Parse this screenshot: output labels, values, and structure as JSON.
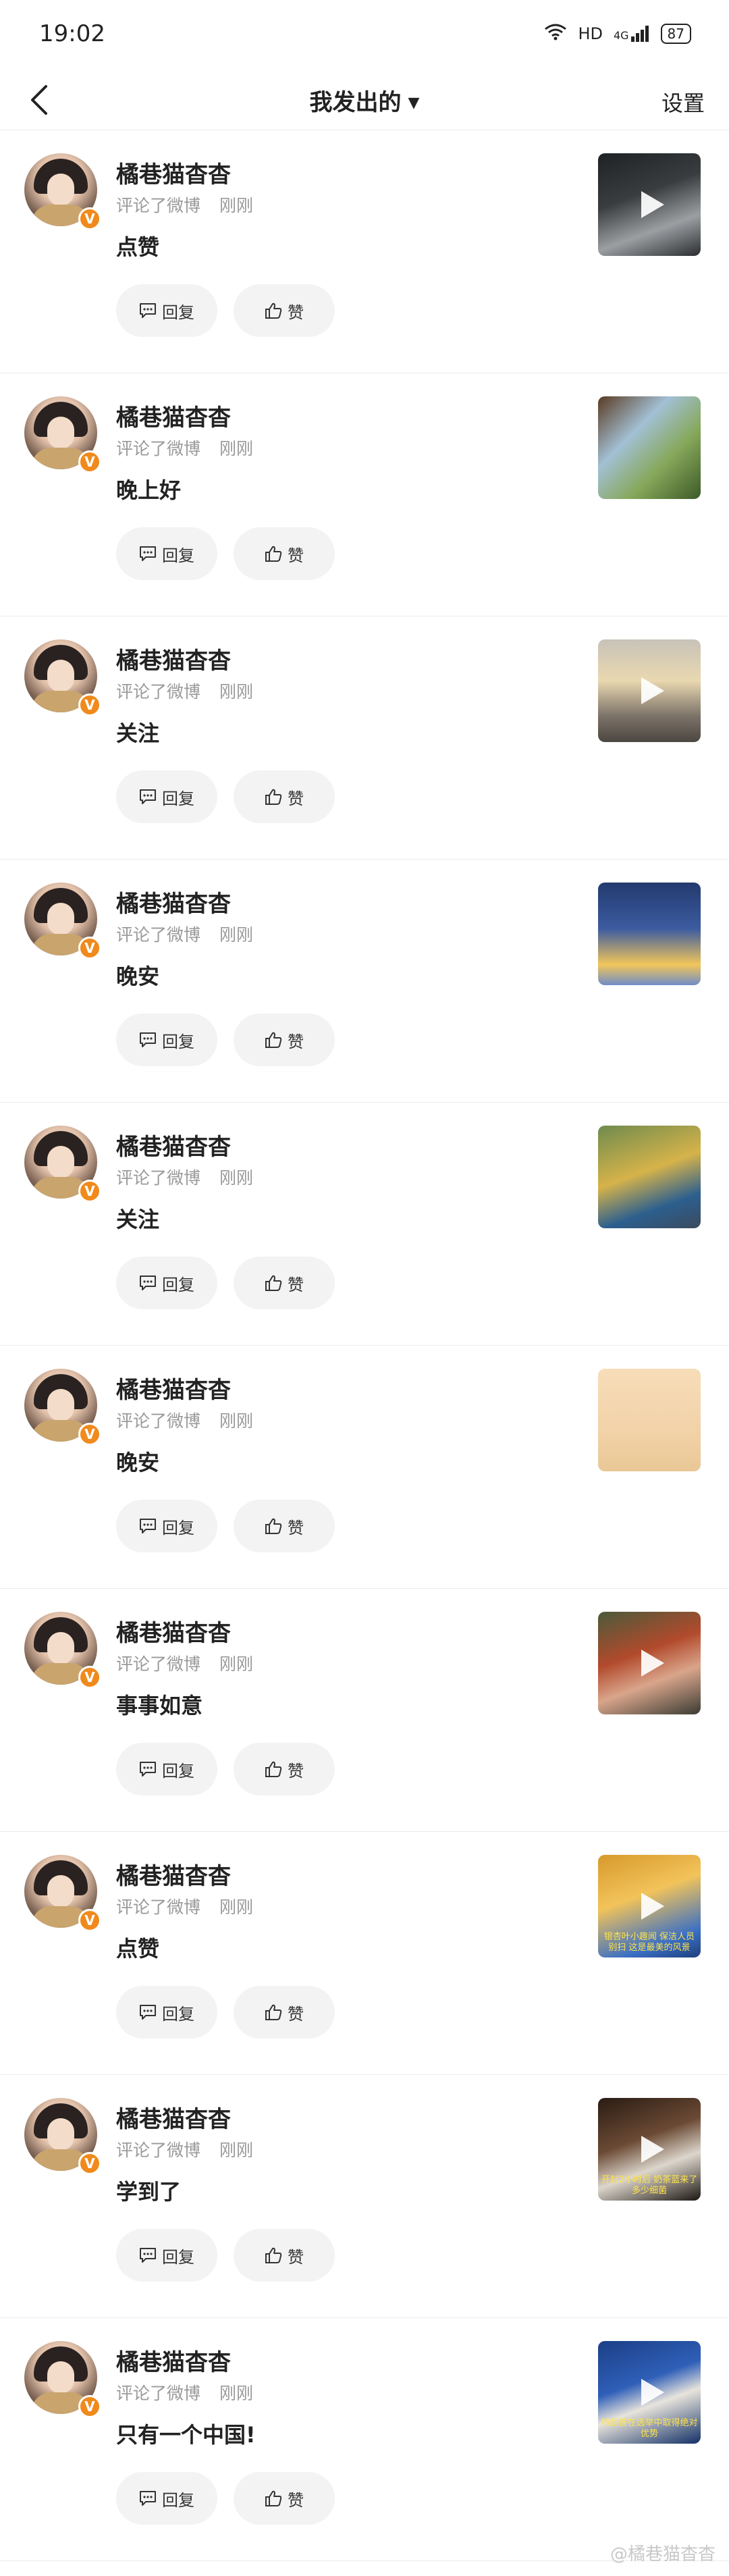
{
  "status_bar": {
    "time": "19:02",
    "network": "HD",
    "signal": "4G",
    "battery": "87"
  },
  "nav": {
    "title": "我发出的",
    "settings": "设置"
  },
  "labels": {
    "reply": "回复",
    "like": "赞"
  },
  "items": [
    {
      "username": "橘巷猫杳杳",
      "action": "评论了微博",
      "time": "刚刚",
      "comment": "点赞"
    },
    {
      "username": "橘巷猫杳杳",
      "action": "评论了微博",
      "time": "刚刚",
      "comment": "晚上好"
    },
    {
      "username": "橘巷猫杳杳",
      "action": "评论了微博",
      "time": "刚刚",
      "comment": "关注"
    },
    {
      "username": "橘巷猫杳杳",
      "action": "评论了微博",
      "time": "刚刚",
      "comment": "晚安"
    },
    {
      "username": "橘巷猫杳杳",
      "action": "评论了微博",
      "time": "刚刚",
      "comment": "关注"
    },
    {
      "username": "橘巷猫杳杳",
      "action": "评论了微博",
      "time": "刚刚",
      "comment": "晚安"
    },
    {
      "username": "橘巷猫杳杳",
      "action": "评论了微博",
      "time": "刚刚",
      "comment": "事事如意"
    },
    {
      "username": "橘巷猫杳杳",
      "action": "评论了微博",
      "time": "刚刚",
      "comment": "点赞",
      "thumb_caption": "银杏叶小趣闻 保洁人员别扫 这是最美的风景"
    },
    {
      "username": "橘巷猫杳杳",
      "action": "评论了微博",
      "time": "刚刚",
      "comment": "学到了",
      "thumb_caption": "开封2小时后 奶茶蓝来了多少细菌"
    },
    {
      "username": "橘巷猫杳杳",
      "action": "评论了微博",
      "time": "刚刚",
      "comment": "只有一个中国!",
      "thumb_caption": "特朗普在选举中取得绝对优势"
    }
  ],
  "watermark": "@橘巷猫杳杳"
}
